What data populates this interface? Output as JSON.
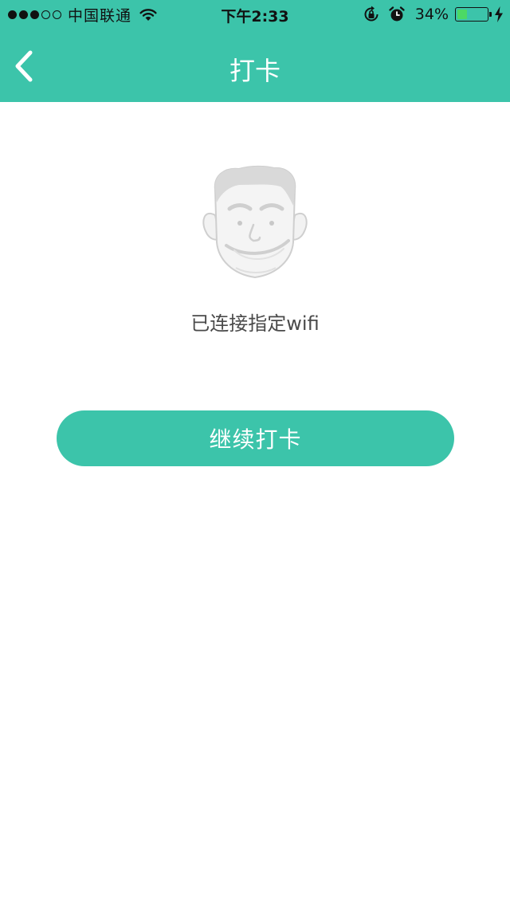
{
  "status_bar": {
    "carrier": "中国联通",
    "time": "下午2:33",
    "battery_percent": "34%",
    "battery_level": 0.34,
    "signal_strength": 3,
    "signal_max": 5,
    "icons": [
      "wifi-icon",
      "rotation-lock-icon",
      "alarm-icon",
      "battery-icon",
      "charging-icon"
    ]
  },
  "nav": {
    "title": "打卡",
    "back_icon": "chevron-left-icon"
  },
  "main": {
    "illustration": "face-illustration",
    "message": "已连接指定wifi",
    "continue_label": "继续打卡"
  },
  "colors": {
    "accent": "#3cc4aa",
    "background": "#ffffff",
    "text": "#4a4a4a",
    "illustration_gray": "#d9d9d9"
  }
}
